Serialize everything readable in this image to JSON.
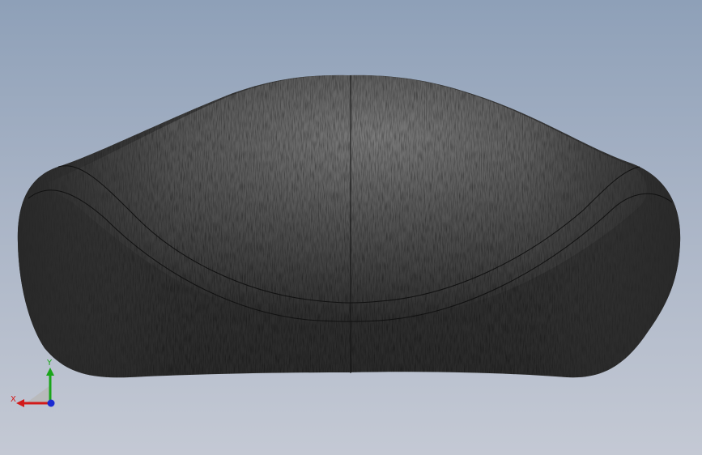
{
  "viewport": {
    "background_top": "#8ea0b8",
    "background_bottom": "#c4c9d4"
  },
  "model": {
    "name": "seat-cushion",
    "body_color": "#3a3a3a",
    "highlight_color": "#6a6a6a",
    "edge_color": "#111111"
  },
  "triad": {
    "x_label": "X",
    "y_label": "Y",
    "x_color": "#d21a1a",
    "y_color": "#1aa51a",
    "z_color": "#1a2ad2"
  }
}
